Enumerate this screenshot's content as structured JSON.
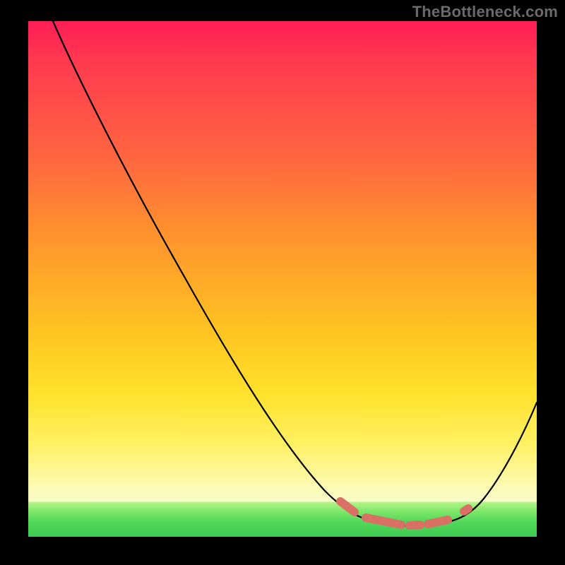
{
  "watermark": "TheBottleneck.com",
  "chart_data": {
    "type": "line",
    "title": "",
    "xlabel": "",
    "ylabel": "",
    "ylim": [
      0,
      100
    ],
    "x": [
      0,
      5,
      10,
      15,
      20,
      25,
      30,
      35,
      40,
      45,
      50,
      55,
      60,
      65,
      68,
      70,
      72,
      75,
      78,
      80,
      82,
      85,
      88,
      92,
      96,
      100
    ],
    "values": [
      100,
      94,
      87,
      80,
      73,
      65,
      58,
      50,
      43,
      35,
      28,
      21,
      14,
      8,
      5,
      3,
      2,
      1,
      1,
      1,
      2,
      4,
      7,
      12,
      18,
      25
    ],
    "optimal_range_x": [
      62,
      82
    ],
    "annotations": []
  }
}
